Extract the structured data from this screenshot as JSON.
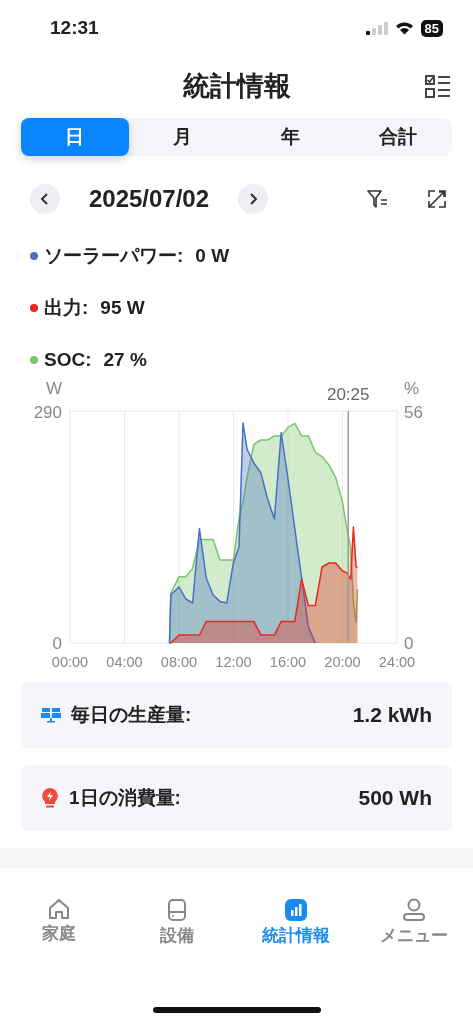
{
  "status_bar": {
    "time": "12:31",
    "battery": "85"
  },
  "header": {
    "title": "統計情報"
  },
  "tabs": [
    {
      "label": "日",
      "selected": true
    },
    {
      "label": "月",
      "selected": false
    },
    {
      "label": "年",
      "selected": false
    },
    {
      "label": "合計",
      "selected": false
    }
  ],
  "date_nav": {
    "date": "2025/07/02"
  },
  "legend": [
    {
      "label": "ソーラーパワー:",
      "value": "0 W",
      "color": "#4a6fc8"
    },
    {
      "label": "出力:",
      "value": "95 W",
      "color": "#e8281e"
    },
    {
      "label": "SOC:",
      "value": "27 %",
      "color": "#7cc66a"
    }
  ],
  "chart": {
    "chart_data": {
      "type": "area",
      "ylabel": "W",
      "y2label": "%",
      "xlim": [
        0,
        24
      ],
      "ylim": [
        0,
        290
      ],
      "y2lim": [
        0,
        56
      ],
      "yticks": [
        0,
        290
      ],
      "y2ticks": [
        0,
        56
      ],
      "xticks": [
        {
          "value": 0,
          "label": "00:00"
        },
        {
          "value": 4,
          "label": "04:00"
        },
        {
          "value": 8,
          "label": "08:00"
        },
        {
          "value": 12,
          "label": "12:00"
        },
        {
          "value": 16,
          "label": "16:00"
        },
        {
          "value": 20,
          "label": "20:00"
        },
        {
          "value": 24,
          "label": "24:00"
        }
      ],
      "x": [
        7.3,
        7.4,
        8,
        8.5,
        9,
        9.5,
        10,
        10.5,
        11,
        11.5,
        12,
        12.4,
        12.7,
        13,
        13.5,
        14,
        14.5,
        15,
        15.5,
        16,
        16.5,
        17,
        17.5,
        18,
        18.5,
        19,
        19.5,
        20,
        20.3,
        20.6,
        20.8,
        21,
        21.1
      ],
      "grid": true,
      "stacked": false,
      "series": [
        {
          "color": "#7cc66a",
          "axis": "y2",
          "values": [
            0,
            12,
            16,
            16,
            18,
            25,
            25,
            25,
            20,
            20,
            20,
            30,
            34,
            40,
            48,
            49,
            49,
            50,
            50,
            52,
            53,
            50,
            50,
            46,
            45,
            43,
            40,
            34,
            28,
            23,
            10,
            5,
            13
          ]
        },
        {
          "color": "#4a6fc8",
          "values": [
            0,
            60,
            70,
            55,
            50,
            143,
            81,
            60,
            52,
            50,
            101,
            120,
            275,
            242,
            225,
            213,
            180,
            155,
            263,
            205,
            143,
            81,
            20,
            0,
            null,
            null,
            null,
            null,
            null,
            null,
            null,
            null,
            null
          ]
        },
        {
          "color": "#e8281e",
          "values": [
            0,
            0,
            10,
            10,
            10,
            10,
            27,
            27,
            27,
            27,
            27,
            27,
            27,
            27,
            27,
            10,
            10,
            10,
            27,
            27,
            27,
            80,
            47,
            47,
            95,
            100,
            100,
            90,
            88,
            80,
            145,
            95,
            95
          ]
        }
      ],
      "annotations": [
        {
          "x": 20.42,
          "text": "20:25"
        }
      ]
    }
  },
  "summary": [
    {
      "kind": "production",
      "label": "毎日の生産量:",
      "value": "1.2 kWh"
    },
    {
      "kind": "consumption",
      "label": "1日の消費量:",
      "value": "500 Wh"
    }
  ],
  "bottom_nav": [
    {
      "kind": "home",
      "label": "家庭",
      "selected": false
    },
    {
      "kind": "device",
      "label": "設備",
      "selected": false
    },
    {
      "kind": "stats",
      "label": "統計情報",
      "selected": true
    },
    {
      "kind": "user",
      "label": "メニュー",
      "selected": false
    }
  ]
}
